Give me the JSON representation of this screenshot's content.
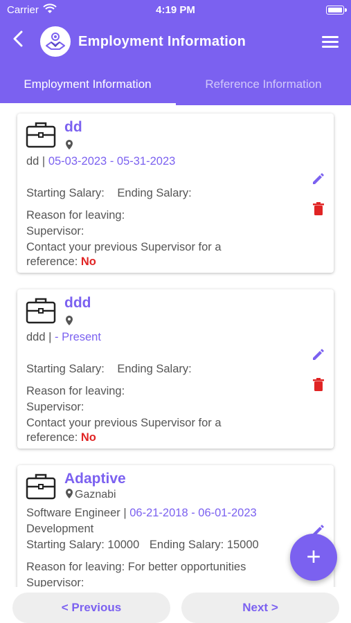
{
  "status_bar": {
    "carrier": "Carrier",
    "time": "4:19 PM"
  },
  "header": {
    "title": "Employment Information",
    "tabs": [
      {
        "label": "Employment Information",
        "active": true
      },
      {
        "label": "Reference Information",
        "active": false
      }
    ]
  },
  "cards": [
    {
      "company": "dd",
      "location": "",
      "position": "dd |",
      "dates": "05-03-2023 - 05-31-2023",
      "department": "",
      "starting_salary_label": "Starting Salary:",
      "starting_salary": "",
      "ending_salary_label": "Ending Salary:",
      "ending_salary": "",
      "reason_label": "Reason for leaving:",
      "reason": "",
      "supervisor_label": "Supervisor:",
      "supervisor": "",
      "contact_line1": "Contact your previous Supervisor for a",
      "contact_line2": "reference:",
      "contact_value": "No"
    },
    {
      "company": "ddd",
      "location": "",
      "position": "ddd |",
      "dates": " - Present",
      "department": "",
      "starting_salary_label": "Starting Salary:",
      "starting_salary": "",
      "ending_salary_label": "Ending Salary:",
      "ending_salary": "",
      "reason_label": "Reason for leaving:",
      "reason": "",
      "supervisor_label": "Supervisor:",
      "supervisor": "",
      "contact_line1": "Contact your previous Supervisor for a",
      "contact_line2": "reference:",
      "contact_value": "No"
    },
    {
      "company": "Adaptive",
      "location": "Gaznabi",
      "position": "Software Engineer |",
      "dates": "06-21-2018 - 06-01-2023",
      "department": "Development",
      "starting_salary_label": "Starting Salary:",
      "starting_salary": "10000",
      "ending_salary_label": "Ending Salary:",
      "ending_salary": "15000",
      "reason_label": "Reason for leaving:",
      "reason": "For better opportunities",
      "supervisor_label": "Supervisor:",
      "supervisor": ""
    }
  ],
  "fab": {
    "label": "+"
  },
  "pager": {
    "previous": "< Previous",
    "next": "Next >"
  },
  "colors": {
    "primary": "#7b61f0",
    "danger": "#e02424",
    "text": "#555555"
  },
  "icons": [
    "back-icon",
    "logo-icon",
    "menu-icon",
    "briefcase-icon",
    "location-pin-icon",
    "edit-icon",
    "delete-icon",
    "add-icon"
  ]
}
